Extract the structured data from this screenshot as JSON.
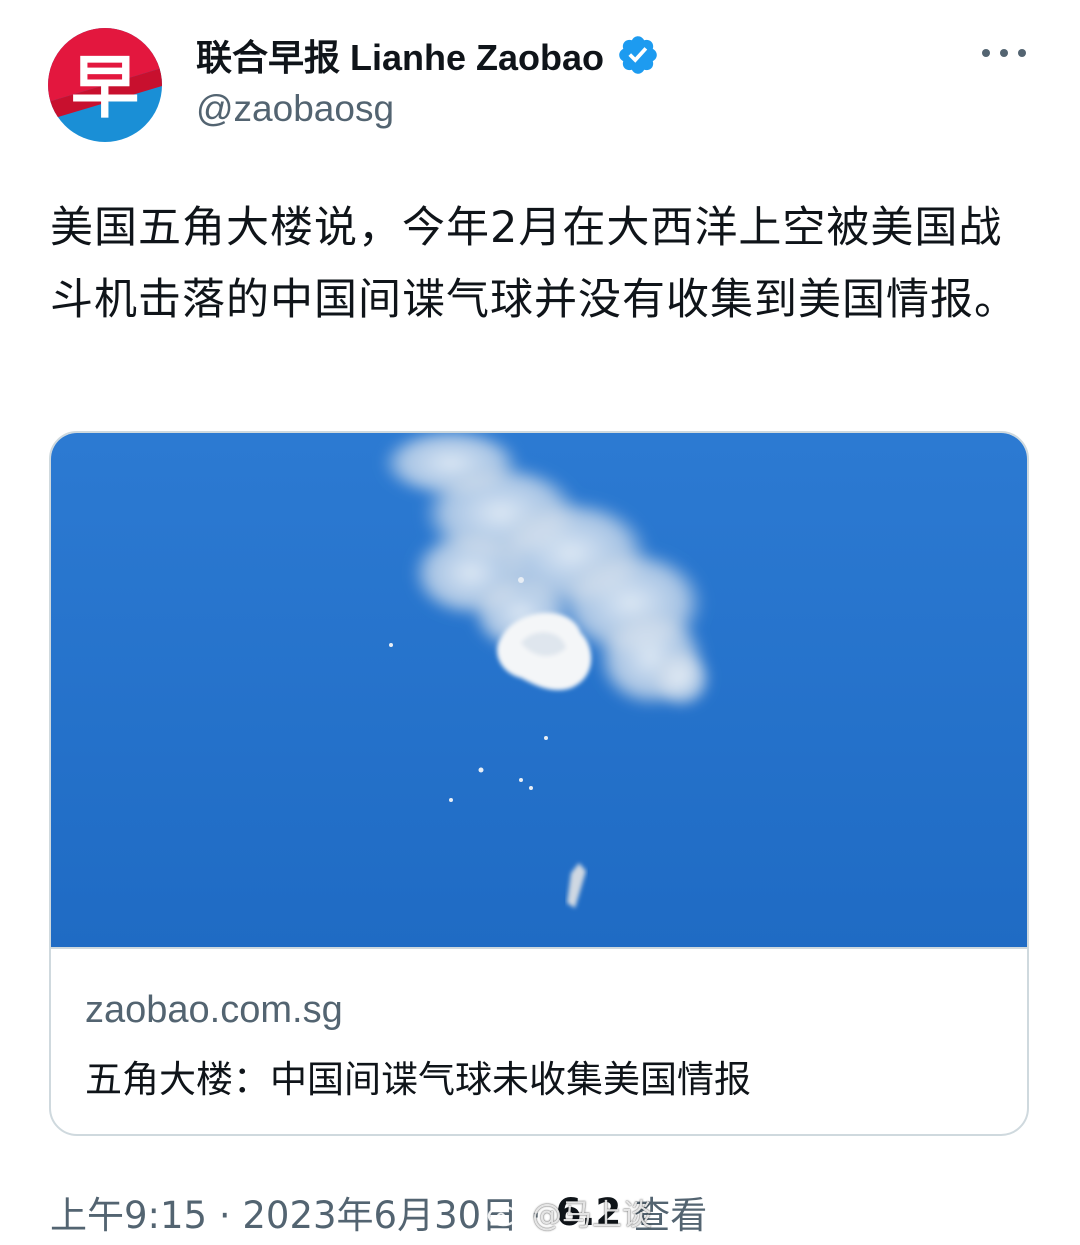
{
  "author": {
    "display_name": "联合早报 Lianhe Zaobao",
    "handle": "@zaobaosg",
    "avatar_char": "早",
    "verified": true,
    "avatar_colors": [
      "#e3173e",
      "#1a8fd6"
    ]
  },
  "tweet": {
    "text": "美国五角大楼说，今年2月在大西洋上空被美国战斗机击落的中国间谍气球并没有收集到美国情报。"
  },
  "card": {
    "domain": "zaobao.com.sg",
    "title": "五角大楼：中国间谍气球未收集美国情报",
    "image_desc_colors": {
      "sky": "#1f6fc9",
      "sky_light": "#2e7fd6"
    }
  },
  "meta": {
    "time": "上午9:15 · 2023年6月30日 · ",
    "views_count": "6.2",
    "views_label": "查看"
  },
  "watermark": {
    "text": "@马上谈"
  },
  "icons": {
    "more": "more-horizontal-icon",
    "verified": "verified-badge-icon",
    "weibo": "weibo-logo-icon"
  },
  "colors": {
    "text_primary": "#0f1419",
    "text_secondary": "#536471",
    "border": "#cfd9de",
    "verified_blue": "#1d9bf0"
  }
}
